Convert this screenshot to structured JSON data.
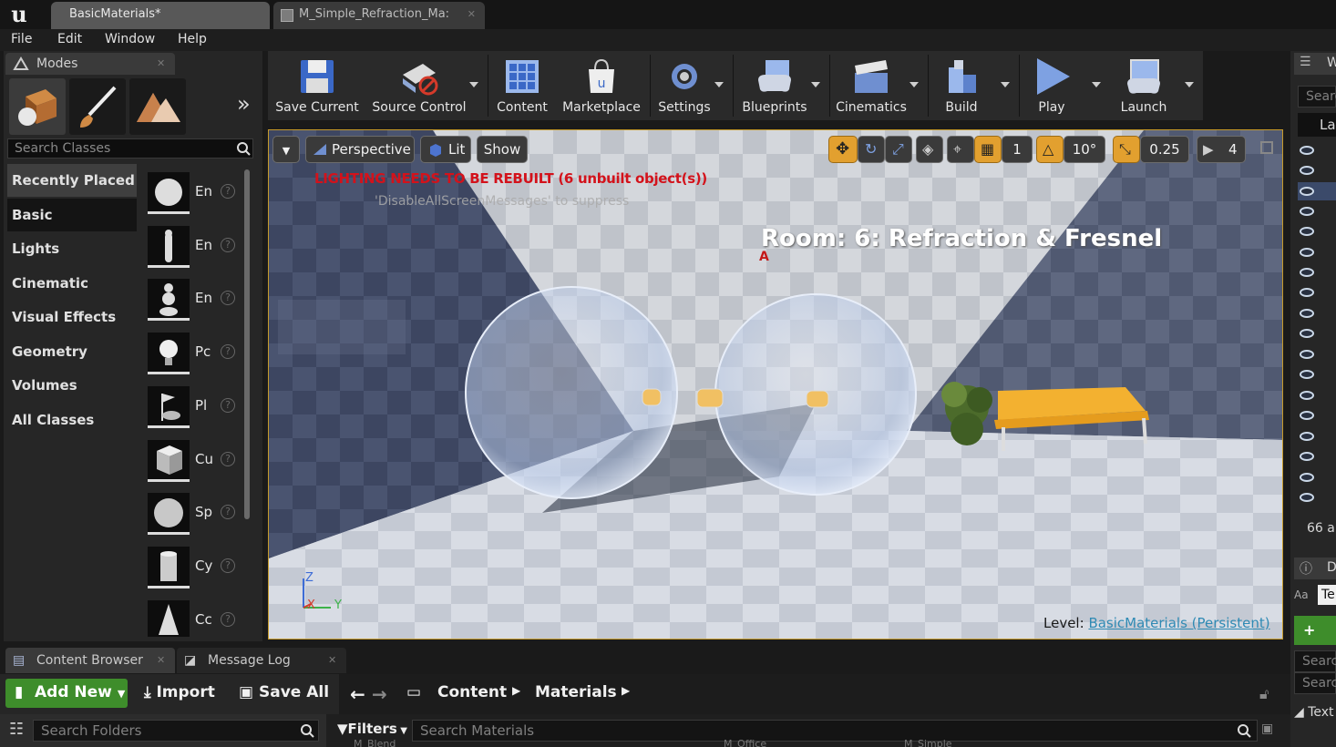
{
  "window": {
    "tabs": [
      {
        "label": "BasicMaterials*"
      },
      {
        "label": "M_Simple_Refraction_Ma:"
      }
    ]
  },
  "menu": [
    "File",
    "Edit",
    "Window",
    "Help"
  ],
  "modes": {
    "tab_label": "Modes",
    "search_placeholder": "Search Classes",
    "categories": [
      "Recently Placed",
      "Basic",
      "Lights",
      "Cinematic",
      "Visual Effects",
      "Geometry",
      "Volumes",
      "All Classes"
    ],
    "selected_category": "Basic",
    "classes": [
      {
        "label": "En",
        "icon": "empty-actor-sphere-icon"
      },
      {
        "label": "En",
        "icon": "empty-character-icon"
      },
      {
        "label": "En",
        "icon": "empty-pawn-icon"
      },
      {
        "label": "Pc",
        "icon": "point-light-icon"
      },
      {
        "label": "Pl",
        "icon": "player-start-icon"
      },
      {
        "label": "Cu",
        "icon": "cube-icon"
      },
      {
        "label": "Sp",
        "icon": "sphere-icon"
      },
      {
        "label": "Cy",
        "icon": "cylinder-icon"
      },
      {
        "label": "Cc",
        "icon": "cone-icon"
      }
    ]
  },
  "toolbar": {
    "buttons": [
      {
        "label": "Save Current",
        "icon": "save-icon"
      },
      {
        "label": "Source Control",
        "icon": "source-control-icon"
      },
      {
        "label": "Content",
        "icon": "content-icon"
      },
      {
        "label": "Marketplace",
        "icon": "marketplace-icon"
      },
      {
        "label": "Settings",
        "icon": "settings-icon"
      },
      {
        "label": "Blueprints",
        "icon": "blueprints-icon"
      },
      {
        "label": "Cinematics",
        "icon": "cinematics-icon"
      },
      {
        "label": "Build",
        "icon": "build-icon"
      },
      {
        "label": "Play",
        "icon": "play-icon"
      },
      {
        "label": "Launch",
        "icon": "launch-icon"
      }
    ]
  },
  "viewport": {
    "perspective_label": "Perspective",
    "lit_label": "Lit",
    "show_label": "Show",
    "grid_snap": "1",
    "rotation_snap": "10°",
    "scale_snap": "0.25",
    "camera_speed": "4",
    "warning": "LIGHTING NEEDS TO BE REBUILT (6 unbuilt object(s))",
    "warning_hint": "'DisableAllScreenMessages' to suppress",
    "room_title": "Room: 6: Refraction & Fresnel",
    "level_label": "Level:",
    "level_name": "BasicMaterials (Persistent)",
    "axis_z": "Z",
    "axis_x": "X",
    "axis_y": "Y"
  },
  "right_panel": {
    "partial_header": "W",
    "search_partial": "Searc",
    "column_partial": "La",
    "count_partial": "66 a",
    "details_partial": "D",
    "text_field_partial": "Te",
    "add_partial": "+ Ac",
    "search2_partial": "Searc",
    "search3_partial": "Searc",
    "text_section_partial": "Text"
  },
  "bottom": {
    "tabs": [
      {
        "label": "Content Browser"
      },
      {
        "label": "Message Log"
      }
    ],
    "add_new": "Add New",
    "import": "Import",
    "save_all": "Save All",
    "breadcrumb": [
      "Content",
      "Materials"
    ],
    "search_folders": "Search Folders",
    "filters": "Filters",
    "search_materials": "Search Materials",
    "asset_partial": [
      "M_Blend",
      "M_Office",
      "M_Simple"
    ]
  },
  "colors": {
    "accent_orange": "#e2a02f",
    "warning_red": "#d3121b",
    "add_new_green": "#3e8d2b",
    "level_link": "#2f8ab4"
  }
}
